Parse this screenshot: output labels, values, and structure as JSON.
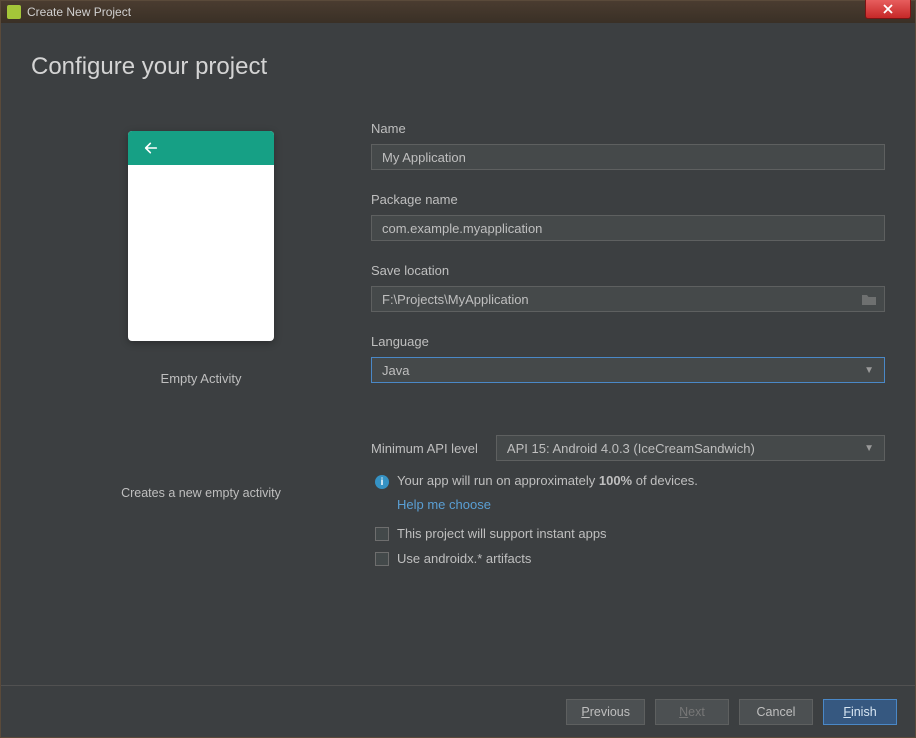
{
  "window": {
    "title": "Create New Project"
  },
  "heading": "Configure your project",
  "preview": {
    "template_name": "Empty Activity",
    "template_desc": "Creates a new empty activity"
  },
  "form": {
    "name_label": "Name",
    "name_value": "My Application",
    "package_label": "Package name",
    "package_value": "com.example.myapplication",
    "location_label": "Save location",
    "location_value": "F:\\Projects\\MyApplication",
    "language_label": "Language",
    "language_value": "Java",
    "api_label": "Minimum API level",
    "api_value": "API 15: Android 4.0.3 (IceCreamSandwich)",
    "info_prefix": "Your app will run on approximately ",
    "info_percent": "100%",
    "info_suffix": " of devices.",
    "help_link": "Help me choose",
    "instant_apps_label": "This project will support instant apps",
    "androidx_label": "Use androidx.* artifacts"
  },
  "footer": {
    "previous": "Previous",
    "next": "Next",
    "cancel": "Cancel",
    "finish": "Finish"
  }
}
